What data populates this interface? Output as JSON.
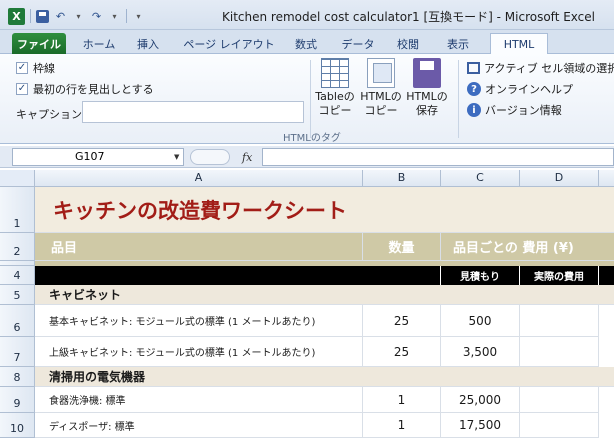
{
  "app": {
    "logo_letter": "X",
    "title": "Kitchen remodel cost calculator1  [互換モード]  -  Microsoft Excel"
  },
  "qat": {
    "undo": "↶",
    "redo": "↷",
    "more": "▾"
  },
  "tabs": [
    "ファイル",
    "ホーム",
    "挿入",
    "ページ レイアウト",
    "数式",
    "データ",
    "校閲",
    "表示",
    "HTML"
  ],
  "active_tab": "HTML",
  "ribbon": {
    "checkbox_gridlines": "枠線",
    "checkbox_first_row": "最初の行を見出しとする",
    "caption_label": "キャプション :",
    "caption_value": "",
    "table_copy_line1": "Tableの",
    "table_copy_line2": "コピー",
    "html_copy_line1": "HTMLの",
    "html_copy_line2": "コピー",
    "html_save_line1": "HTMLの",
    "html_save_line2": "保存",
    "active_select": "アクティブ セル領域の選択",
    "online_help": "オンラインヘルプ",
    "version_info": "バージョン情報",
    "group_label": "HTMLのタグ"
  },
  "formula_bar": {
    "name_box": "G107",
    "fx": "fx",
    "formula": ""
  },
  "columns": [
    "A",
    "B",
    "C",
    "D"
  ],
  "rows": {
    "r1": {
      "num": "1",
      "title": "キッチンの改造費ワークシート"
    },
    "r2": {
      "num": "2",
      "item": "品目",
      "qty": "数量",
      "cost": "品目ごとの 費用 (¥)"
    },
    "r4": {
      "num": "4",
      "estimate": "見積もり",
      "actual": "実際の費用"
    },
    "r5": {
      "num": "5",
      "section": "キャビネット"
    },
    "r6": {
      "num": "6",
      "item": "基本キャビネット: モジュール式の標準 (1 メートルあたり)",
      "qty": "25",
      "cost": "500"
    },
    "r7": {
      "num": "7",
      "item": "上級キャビネット: モジュール式の標準 (1 メートルあたり)",
      "qty": "25",
      "cost": "3,500"
    },
    "r8": {
      "num": "8",
      "section": "清掃用の電気機器"
    },
    "r9": {
      "num": "9",
      "item": "食器洗浄機: 標準",
      "qty": "1",
      "cost": "25,000"
    },
    "r10": {
      "num": "10",
      "item": "ディスポーザ: 標準",
      "qty": "1",
      "cost": "17,500"
    }
  },
  "colors": {
    "title_red": "#a21d17",
    "header_tan": "#cfc9a6",
    "section_beige": "#eee8dc",
    "file_tab_green": "#1b6b2a"
  }
}
